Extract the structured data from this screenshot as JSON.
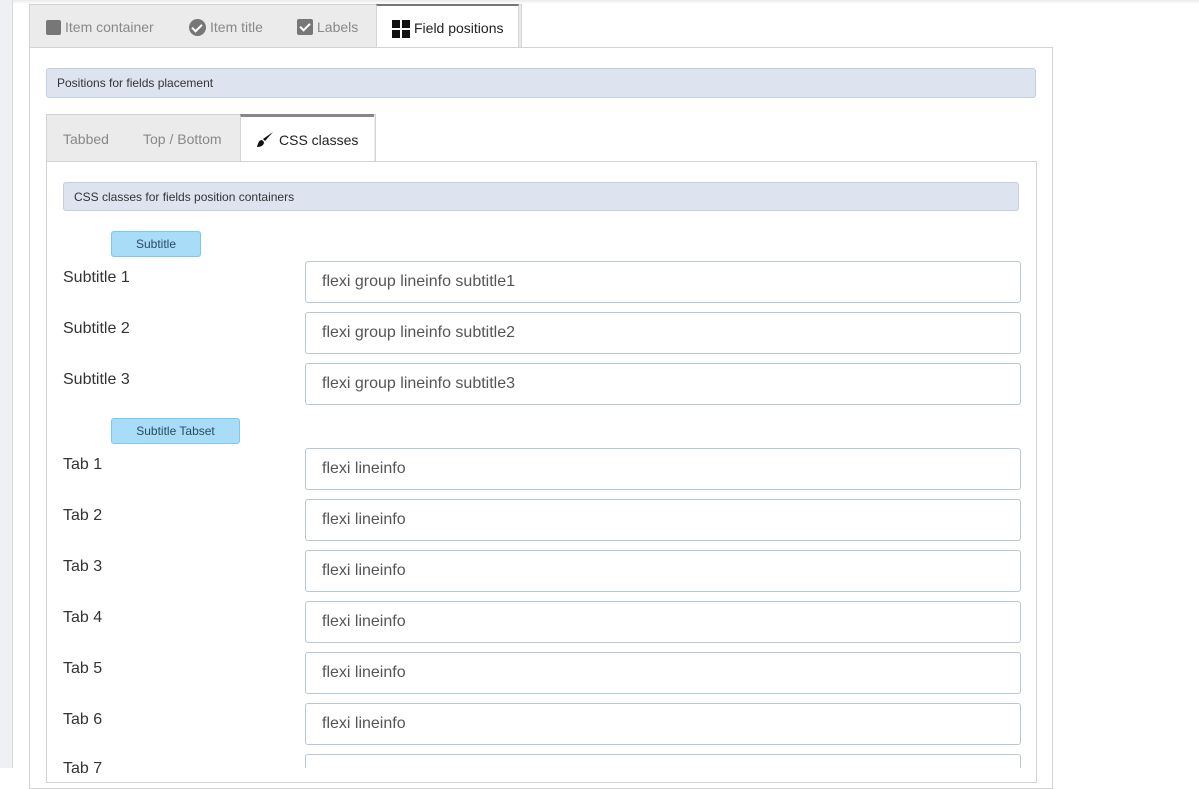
{
  "outer_tabs": [
    {
      "label": "Item container",
      "icon": "square-icon"
    },
    {
      "label": "Item title",
      "icon": "circle-check-icon"
    },
    {
      "label": "Labels",
      "icon": "checkbox-icon"
    },
    {
      "label": "Field positions",
      "icon": "grid-icon"
    }
  ],
  "positions_bar": "Positions for fields placement",
  "inner_tabs": [
    {
      "label": "Tabbed"
    },
    {
      "label": "Top / Bottom"
    },
    {
      "label": "CSS classes",
      "icon": "brush-icon"
    }
  ],
  "css_bar": "CSS classes for fields position containers",
  "subtitle_badge": "Subtitle",
  "subtitle_rows": [
    {
      "label": "Subtitle 1",
      "value": "flexi group lineinfo subtitle1"
    },
    {
      "label": "Subtitle 2",
      "value": "flexi group lineinfo subtitle2"
    },
    {
      "label": "Subtitle 3",
      "value": "flexi group lineinfo subtitle3"
    }
  ],
  "tabset_badge": "Subtitle Tabset",
  "tab_rows": [
    {
      "label": "Tab 1",
      "value": "flexi lineinfo"
    },
    {
      "label": "Tab 2",
      "value": "flexi lineinfo"
    },
    {
      "label": "Tab 3",
      "value": "flexi lineinfo"
    },
    {
      "label": "Tab 4",
      "value": "flexi lineinfo"
    },
    {
      "label": "Tab 5",
      "value": "flexi lineinfo"
    },
    {
      "label": "Tab 6",
      "value": "flexi lineinfo"
    },
    {
      "label": "Tab 7",
      "value": ""
    }
  ],
  "colors": {
    "accent_badge": "#a8dcf7",
    "bar_bg": "#dde4f0"
  }
}
